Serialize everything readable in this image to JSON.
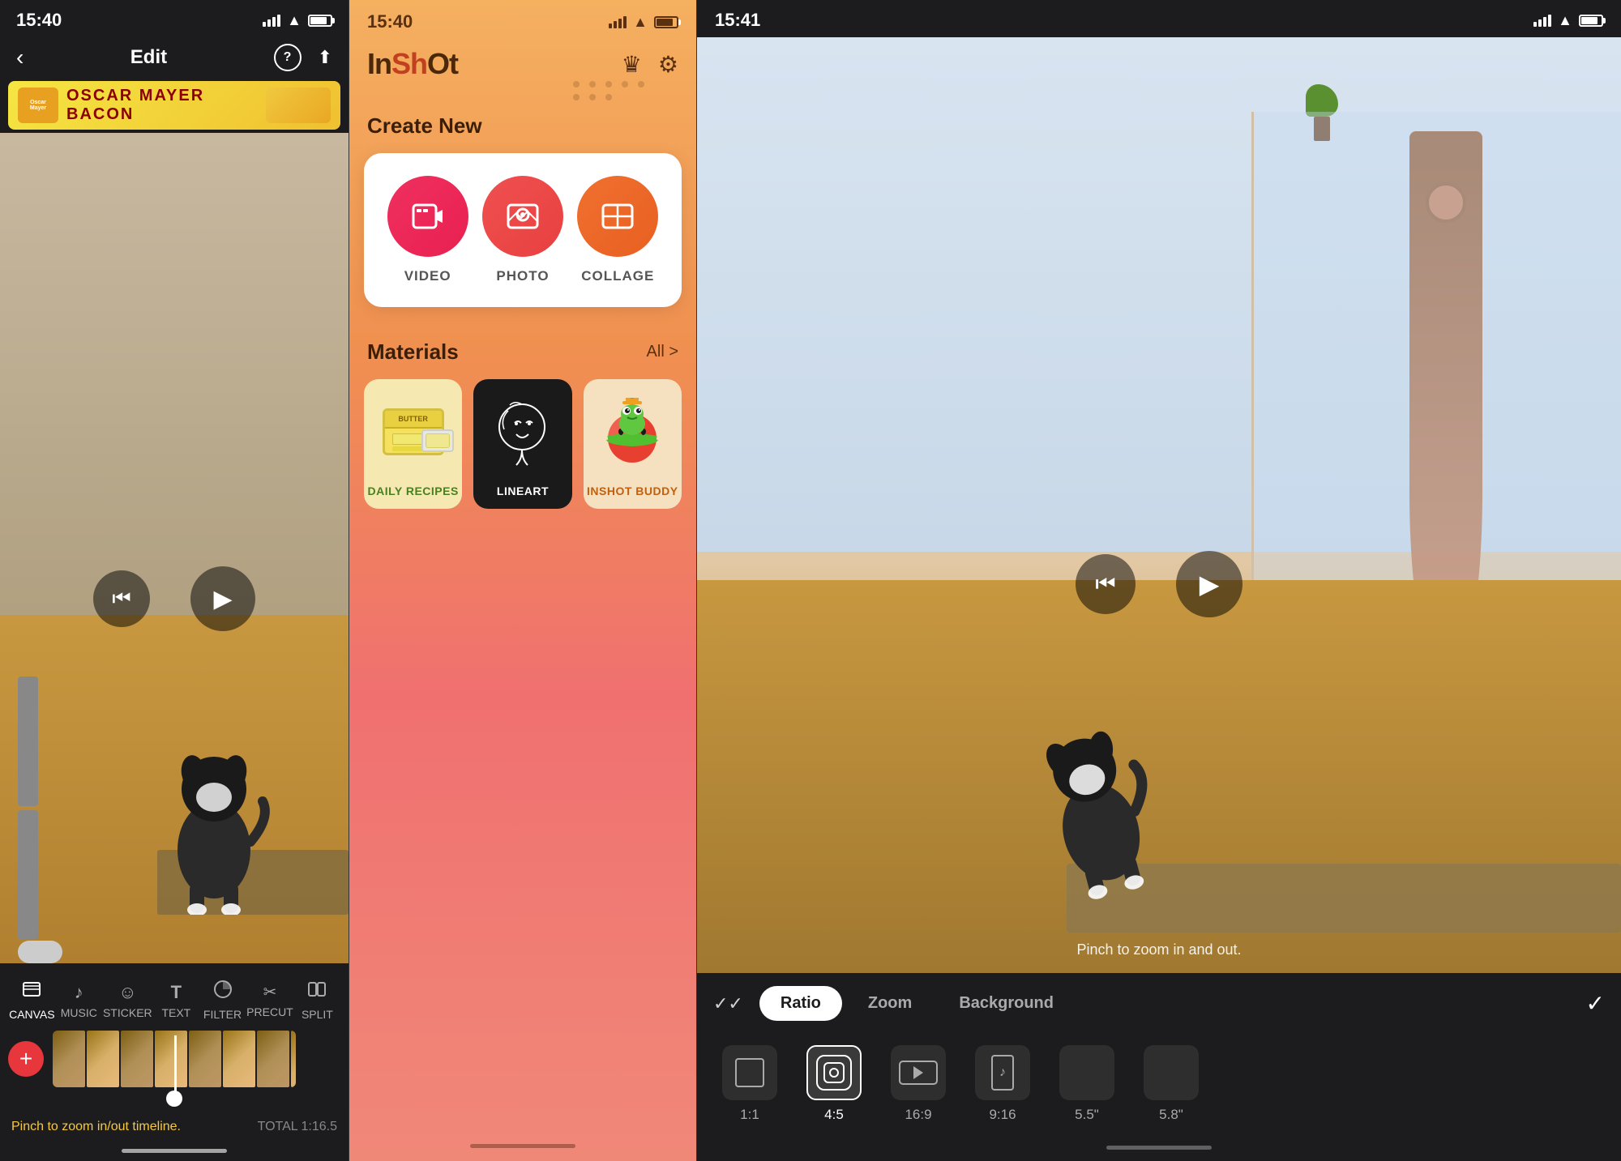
{
  "panel1": {
    "status": {
      "time": "15:40",
      "location_arrow": "▶"
    },
    "nav": {
      "back": "‹",
      "title": "Edit",
      "help": "?",
      "share": "↑"
    },
    "ad": {
      "brand": "Oscar Mayer",
      "text": "OSCAR  MAYER  BACON"
    },
    "playback": {
      "rewind": "⏮",
      "play": "▶"
    },
    "tools": [
      {
        "label": "CANVAS",
        "icon": "≡",
        "active": true
      },
      {
        "label": "MUSIC",
        "icon": "♪",
        "active": false
      },
      {
        "label": "STICKER",
        "icon": "☺",
        "active": false
      },
      {
        "label": "TEXT",
        "icon": "T",
        "active": false
      },
      {
        "label": "FILTER",
        "icon": "●",
        "active": false
      },
      {
        "label": "PRECUT",
        "icon": "✂",
        "active": false
      },
      {
        "label": "SPLIT",
        "icon": "⊞",
        "active": false
      }
    ],
    "timeline": {
      "hint": "Pinch to zoom in/out timeline.",
      "total": "TOTAL 1:16.5",
      "add_btn": "+"
    }
  },
  "panel2": {
    "status": {
      "time": "15:40",
      "location_arrow": "▶"
    },
    "header": {
      "logo": "InShOt",
      "crown": "♛",
      "gear": "⚙"
    },
    "create": {
      "title": "Create New",
      "items": [
        {
          "label": "VIDEO",
          "type": "video"
        },
        {
          "label": "PHOTO",
          "type": "photo"
        },
        {
          "label": "COLLAGE",
          "type": "collage"
        }
      ]
    },
    "materials": {
      "title": "Materials",
      "all_label": "All >",
      "items": [
        {
          "label": "DAILY RECIPES",
          "theme": "recipes"
        },
        {
          "label": "LINEART",
          "theme": "lineart"
        },
        {
          "label": "INSHOT BUDDY",
          "theme": "buddy"
        }
      ]
    }
  },
  "panel3": {
    "status": {
      "time": "15:41",
      "location_arrow": "▶"
    },
    "video_hint": "Pinch to zoom in and out.",
    "controls": {
      "back_check": "✓✓",
      "check": "✓"
    },
    "tabs": [
      {
        "label": "Ratio",
        "active": true
      },
      {
        "label": "Zoom",
        "active": false
      },
      {
        "label": "Background",
        "active": false
      }
    ],
    "ratios": [
      {
        "label": "1:1",
        "active": false,
        "type": "square"
      },
      {
        "label": "4:5",
        "active": true,
        "type": "portrait45"
      },
      {
        "label": "16:9",
        "active": false,
        "type": "landscape"
      },
      {
        "label": "9:16",
        "active": false,
        "type": "portrait916"
      },
      {
        "label": "5.5\"",
        "active": false,
        "type": "apple"
      },
      {
        "label": "5.8\"",
        "active": false,
        "type": "apple2"
      }
    ]
  }
}
